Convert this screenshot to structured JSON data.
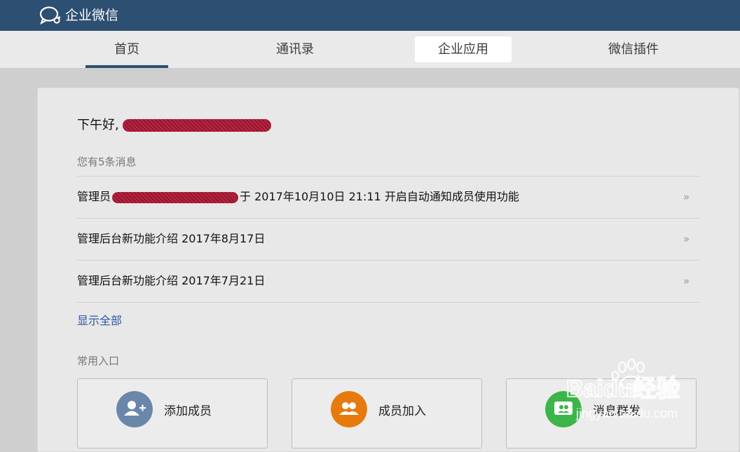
{
  "header": {
    "brand": "企业微信",
    "logo_icon": "wework-chat-logo-icon"
  },
  "nav": {
    "tabs": [
      {
        "label": "首页",
        "state": "active"
      },
      {
        "label": "通讯录",
        "state": "normal"
      },
      {
        "label": "企业应用",
        "state": "hover"
      },
      {
        "label": "微信插件",
        "state": "normal"
      }
    ]
  },
  "main": {
    "greeting": "下午好,",
    "message_count": "您有5条消息",
    "messages": [
      {
        "prefix": "管理员",
        "text": "于 2017年10月10日 21:11 开启自动通知成员使用功能",
        "arrow": "»"
      },
      {
        "text": "管理后台新功能介绍 2017年8月17日",
        "arrow": "»"
      },
      {
        "text": "管理后台新功能介绍 2017年7月21日",
        "arrow": "»"
      }
    ],
    "show_all": "显示全部",
    "shortcuts_title": "常用入口",
    "shortcuts": [
      {
        "label": "添加成员",
        "icon": "add-member-icon",
        "color": "#6a86ab"
      },
      {
        "label": "成员加入",
        "icon": "member-join-icon",
        "color": "#e67a0c"
      },
      {
        "label": "消息群发",
        "icon": "broadcast-message-icon",
        "color": "#3cb54a"
      }
    ]
  },
  "watermark": {
    "brand": "Baidu经验",
    "domain": "jingyan.baidu.com"
  },
  "colors": {
    "header_bg": "#2d4f72",
    "link": "#2a5aa0"
  }
}
